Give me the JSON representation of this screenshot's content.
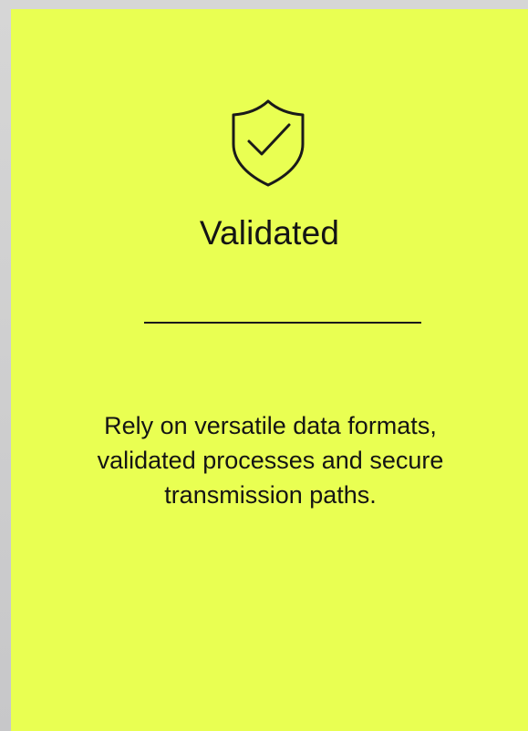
{
  "feature_card": {
    "icon": "shield-check-icon",
    "title": "Validated",
    "description": "Rely on versatile data formats, validated processes and secure transmission paths.",
    "colors": {
      "card_background": "#e9ff52",
      "text": "#141414",
      "page_background": "#d6d6d6"
    }
  }
}
